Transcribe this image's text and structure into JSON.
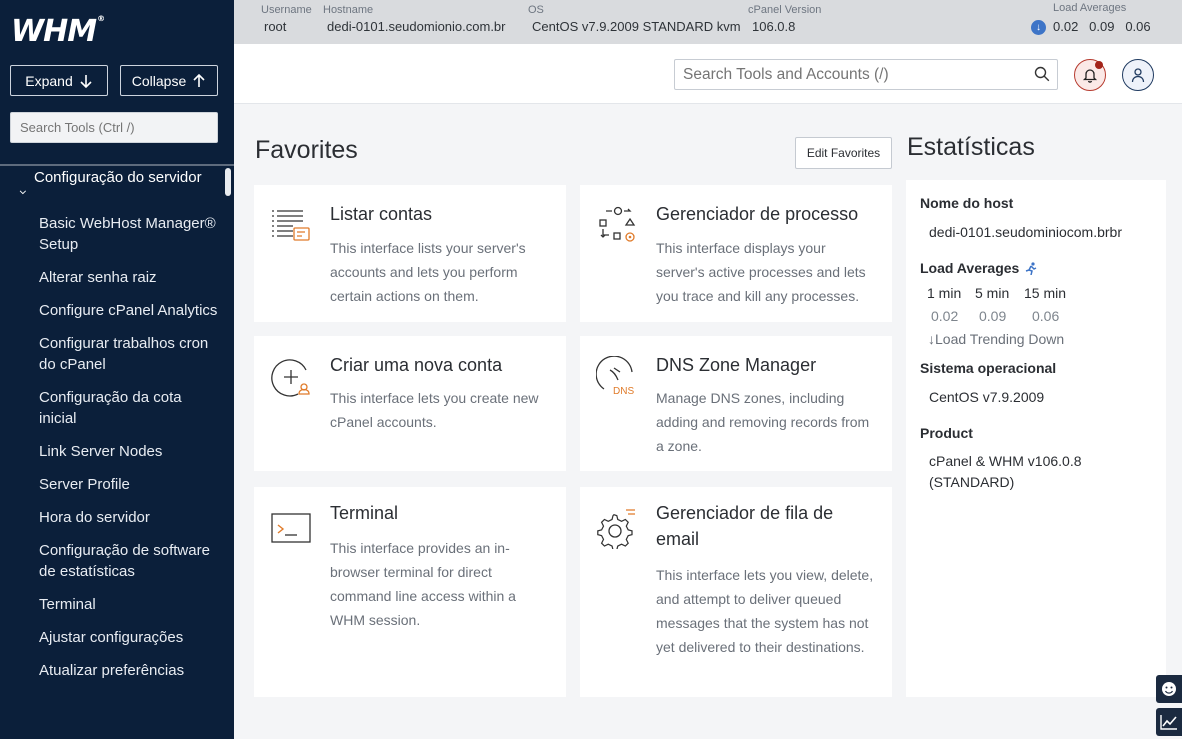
{
  "sidebar": {
    "logo": "WHM",
    "logo_mark": "®",
    "expand_label": "Expand",
    "collapse_label": "Collapse",
    "search_placeholder": "Search Tools (Ctrl /)",
    "group_label": "Configuração do servidor",
    "items": [
      "Basic WebHost Manager® Setup",
      "Alterar senha raiz",
      "Configure cPanel Analytics",
      "Configurar trabalhos cron do cPanel",
      "Configuração da cota inicial",
      "Link Server Nodes",
      "Server Profile",
      "Hora do servidor",
      "Configuração de software de estatísticas",
      "Terminal",
      "Ajustar configurações",
      "Atualizar preferências"
    ]
  },
  "topbar": {
    "username_label": "Username",
    "username": "root",
    "hostname_label": "Hostname",
    "hostname": "dedi-0101.seudomionio.com.br",
    "os_label": "OS",
    "os": "CentOS v7.9.2009 STANDARD kvm",
    "cpanel_label": "cPanel Version",
    "cpanel": "106.0.8",
    "load_label": "Load Averages",
    "load": [
      "0.02",
      "0.09",
      "0.06"
    ]
  },
  "header": {
    "search_placeholder": "Search Tools and Accounts (/)"
  },
  "favorites": {
    "title": "Favorites",
    "edit_label": "Edit Favorites",
    "cards": [
      {
        "title": "Listar contas",
        "desc": "This interface lists your server's accounts and lets you perform certain actions on them."
      },
      {
        "title": "Gerenciador de processo",
        "desc": "This interface displays your server's active processes and lets you trace and kill any processes."
      },
      {
        "title": "Criar uma nova conta",
        "desc": "This interface lets you create new cPanel accounts."
      },
      {
        "title": "DNS Zone Manager",
        "desc": "Manage DNS zones, including adding and removing records from a zone."
      },
      {
        "title": "Terminal",
        "desc": "This interface provides an in-browser terminal for direct command line access within a WHM session."
      },
      {
        "title": "Gerenciador de fila de email",
        "desc": "This interface lets you view, delete, and attempt to deliver queued messages that the system has not yet delivered to their destinations."
      }
    ],
    "dns_badge": "DNS"
  },
  "stats": {
    "title": "Estatísticas",
    "host_label": "Nome do host",
    "host": "dedi-0101.seudominiocom.brbr",
    "load_label": "Load Averages",
    "load_headers": [
      "1 min",
      "5 min",
      "15 min"
    ],
    "load_values": [
      "0.02",
      "0.09",
      "0.06"
    ],
    "trend": "Load Trending Down",
    "os_label": "Sistema operacional",
    "os": "CentOS v7.9.2009",
    "product_label": "Product",
    "product": "cPanel & WHM v106.0.8 (STANDARD)"
  },
  "colors": {
    "sidebar_bg": "#0b1f3a",
    "accent": "#3d74c7",
    "notification": "#b63a2e",
    "icon_orange": "#e07b2a"
  }
}
